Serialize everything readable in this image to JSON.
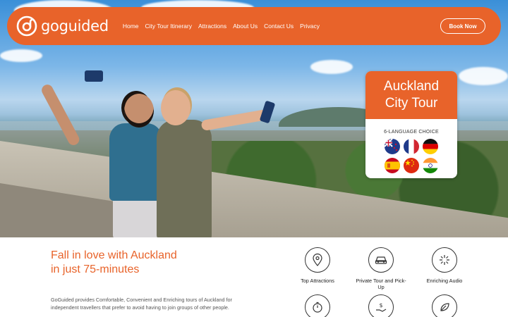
{
  "brand": {
    "name": "goguided",
    "accent": "#e8632a"
  },
  "nav": {
    "items": [
      "Home",
      "City Tour Itinerary",
      "Attractions",
      "About Us",
      "Contact Us",
      "Privacy"
    ],
    "cta": "Book Now"
  },
  "tour_card": {
    "title_line1": "Auckland",
    "title_line2": "City Tour",
    "subtitle": "6-LANGUAGE CHOICE",
    "flags": [
      "new-zealand-flag",
      "france-flag",
      "germany-flag",
      "spain-flag",
      "china-flag",
      "india-flag"
    ]
  },
  "intro": {
    "headline_line1": "Fall in love with Auckland",
    "headline_line2": "in just 75-minutes",
    "body": "GoGuided provides Comfortable, Convenient and Enriching tours of Auckland for independent travellers that prefer to avoid having to join groups of other people."
  },
  "features": [
    {
      "label": "Top Attractions",
      "icon": "map-pin-icon"
    },
    {
      "label": "Private Tour and Pick-Up",
      "icon": "car-icon"
    },
    {
      "label": "Enriching Audio",
      "icon": "sparkle-icon"
    },
    {
      "label": "",
      "icon": "timer-icon"
    },
    {
      "label": "",
      "icon": "money-hand-icon"
    },
    {
      "label": "",
      "icon": "leaf-icon"
    }
  ]
}
